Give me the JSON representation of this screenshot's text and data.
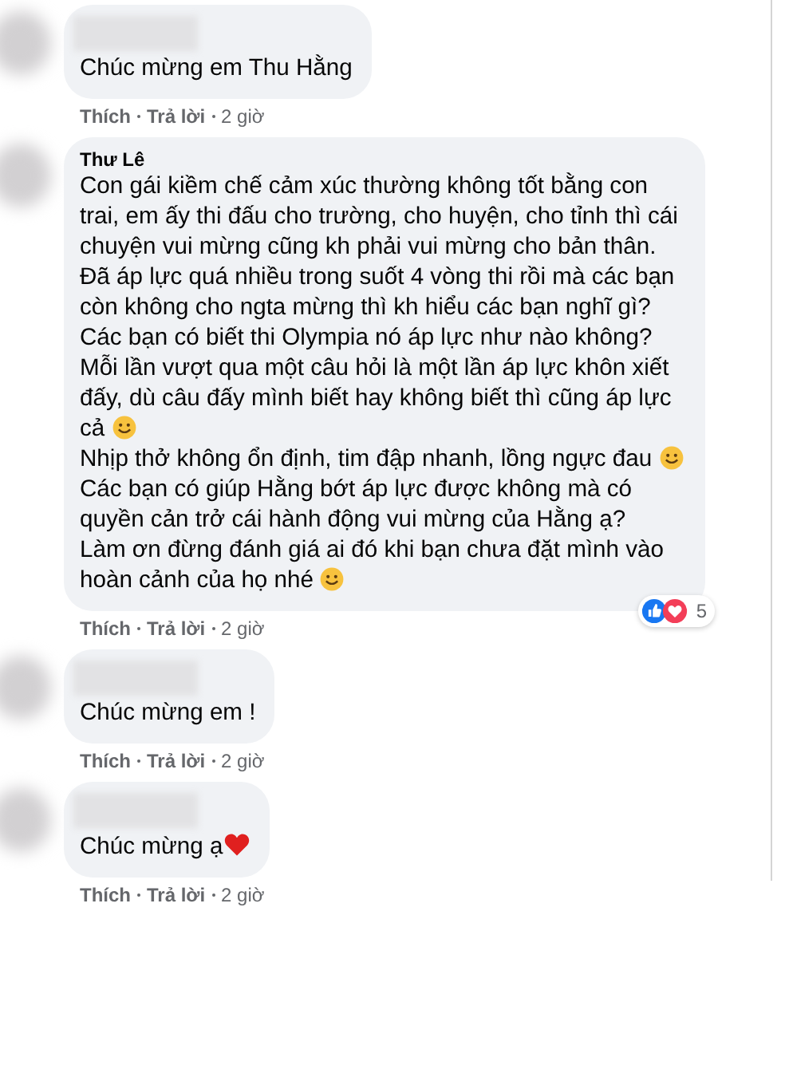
{
  "comments": [
    {
      "name_blurred": true,
      "paragraphs": [
        {
          "text": "Chúc mừng em Thu Hằng",
          "smiley": false,
          "heart": false
        }
      ],
      "actions": {
        "like": "Thích",
        "reply": "Trả lời",
        "time": "2 giờ"
      }
    },
    {
      "name_blurred": false,
      "name": "Thư Lê",
      "paragraphs": [
        {
          "text": "Con gái kiềm chế cảm xúc thường không tốt bằng con trai, em ấy thi đấu cho trường, cho huyện, cho tỉnh thì cái chuyện vui mừng cũng kh phải vui mừng cho bản thân.",
          "smiley": false,
          "heart": false
        },
        {
          "text": "Đã áp lực quá nhiều trong suốt 4 vòng thi rồi mà các bạn còn không cho ngta mừng thì kh hiểu các bạn nghĩ gì?",
          "smiley": false,
          "heart": false
        },
        {
          "text": "Các bạn có biết thi Olympia nó áp lực như nào không?",
          "smiley": false,
          "heart": false
        },
        {
          "text": "Mỗi lần vượt qua một câu hỏi là một lần áp lực khôn xiết đấy, dù câu đấy mình biết hay không biết thì cũng áp lực cả",
          "smiley": true,
          "heart": false
        },
        {
          "text": "Nhịp thở không ổn định, tim đập nhanh, lồng ngực đau",
          "smiley": true,
          "heart": false
        },
        {
          "text": "Các bạn có giúp Hằng bớt áp lực được không mà có quyền cản trở cái hành động vui mừng của Hằng ạ?",
          "smiley": false,
          "heart": false
        },
        {
          "text": "Làm ơn đừng đánh giá ai đó khi bạn chưa đặt mình vào hoàn cảnh của họ nhé",
          "smiley": true,
          "heart": false
        }
      ],
      "reactions": {
        "count": "5"
      },
      "actions": {
        "like": "Thích",
        "reply": "Trả lời",
        "time": "2 giờ"
      }
    },
    {
      "name_blurred": true,
      "paragraphs": [
        {
          "text": "Chúc mừng em !",
          "smiley": false,
          "heart": false
        }
      ],
      "actions": {
        "like": "Thích",
        "reply": "Trả lời",
        "time": "2 giờ"
      }
    },
    {
      "name_blurred": true,
      "paragraphs": [
        {
          "text": "Chúc mừng ạ",
          "smiley": false,
          "heart": true
        }
      ],
      "actions": {
        "like": "Thích",
        "reply": "Trả lời",
        "time": "2 giờ"
      }
    }
  ]
}
